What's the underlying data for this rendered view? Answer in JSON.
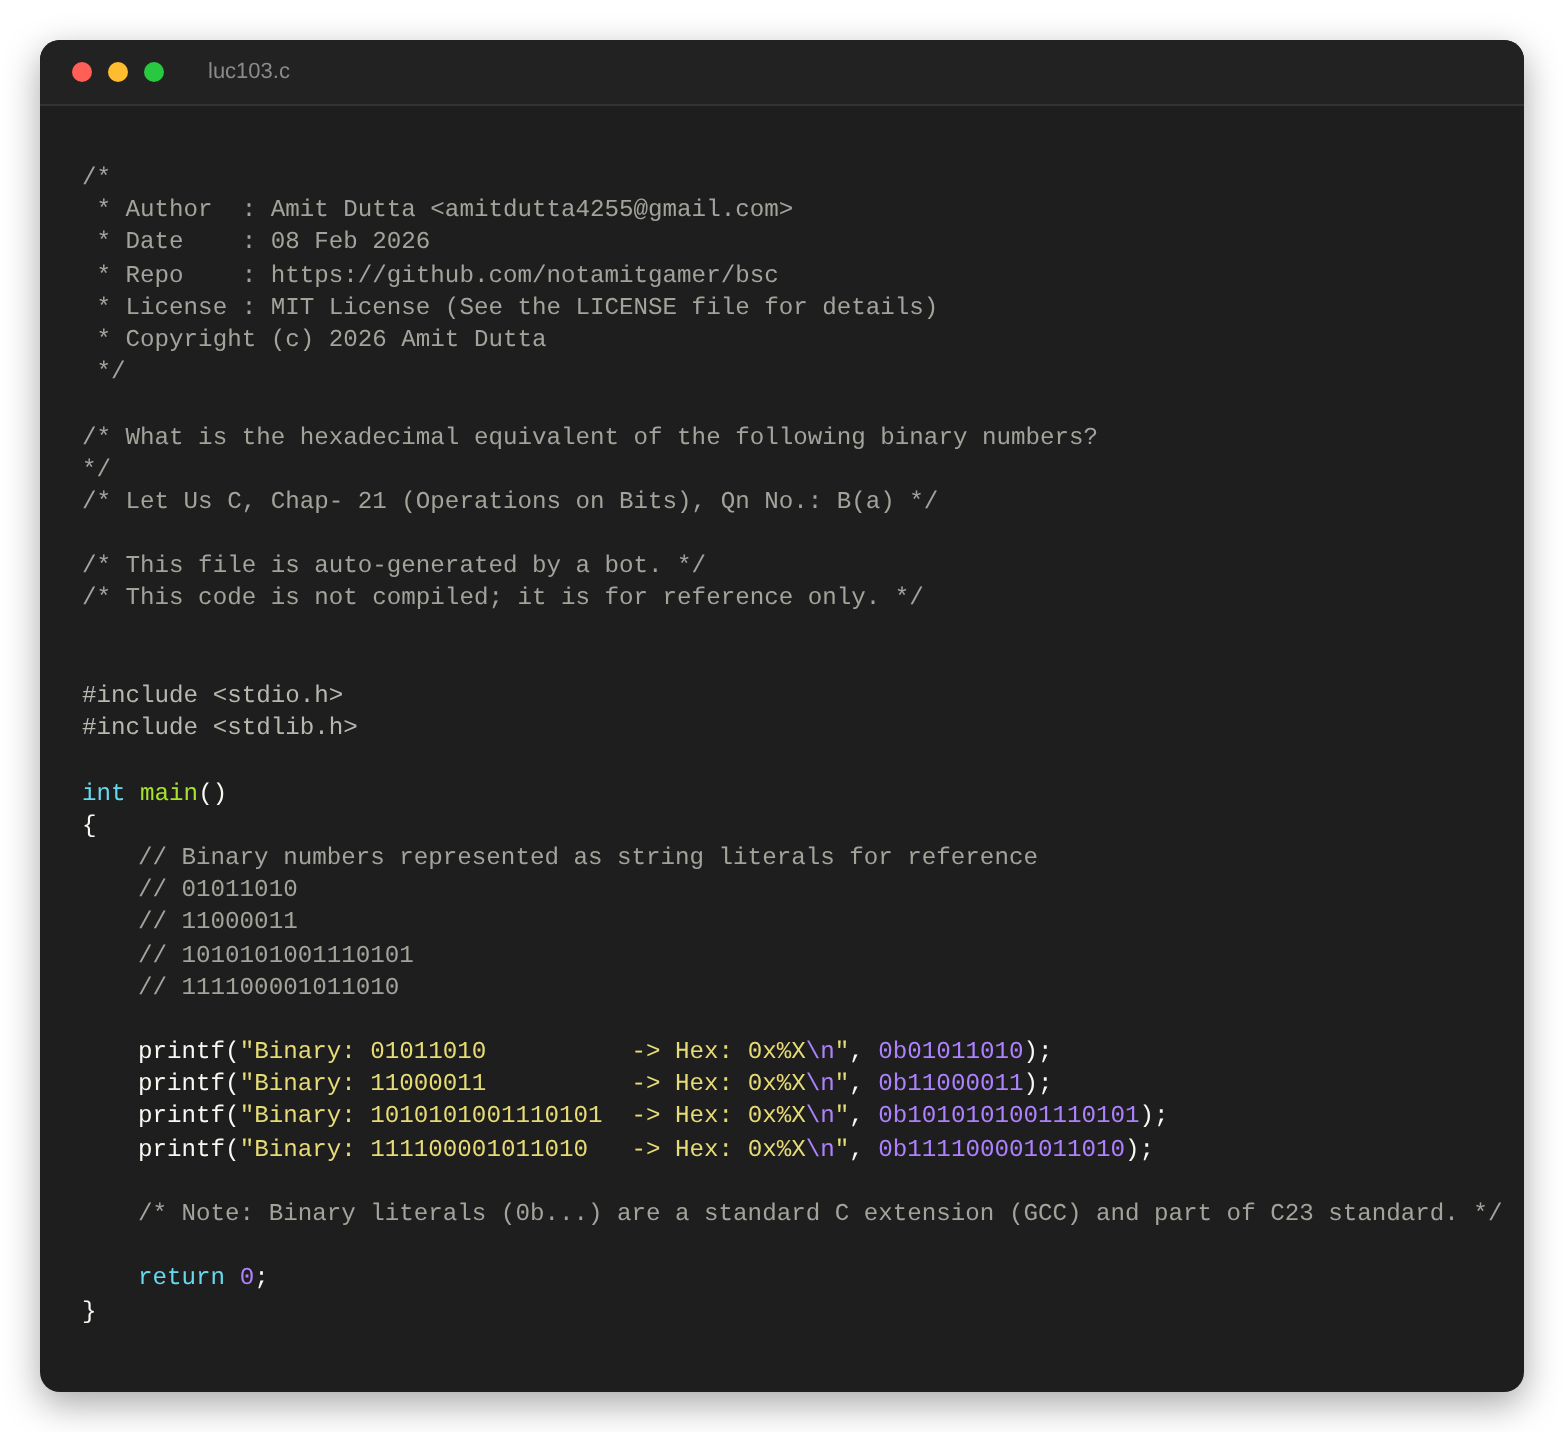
{
  "window": {
    "title": "luc103.c"
  },
  "blocks": [
    {
      "kind": "first",
      "lines": [
        {
          "indented": false,
          "tokens": [
            {
              "kind": "comment",
              "text": "/*"
            }
          ]
        },
        {
          "indented": false,
          "tokens": [
            {
              "kind": "comment",
              "text": " * Author  : Amit Dutta <amitdutta4255@gmail.com>"
            }
          ]
        },
        {
          "indented": false,
          "tokens": [
            {
              "kind": "comment",
              "text": " * Date    : 08 Feb 2026"
            }
          ]
        },
        {
          "indented": false,
          "tokens": [
            {
              "kind": "comment",
              "text": " * Repo    : https://github.com/notamitgamer/bsc"
            }
          ]
        },
        {
          "indented": false,
          "tokens": [
            {
              "kind": "comment",
              "text": " * License : MIT License (See the LICENSE file for details)"
            }
          ]
        },
        {
          "indented": false,
          "tokens": [
            {
              "kind": "comment",
              "text": " * Copyright (c) 2026 Amit Dutta"
            }
          ]
        },
        {
          "indented": false,
          "tokens": [
            {
              "kind": "comment",
              "text": " */"
            }
          ]
        }
      ]
    },
    {
      "kind": "section",
      "lines": [
        {
          "indented": false,
          "tokens": [
            {
              "kind": "comment",
              "text": "/* What is the hexadecimal equivalent of the following binary numbers?"
            }
          ]
        },
        {
          "indented": false,
          "tokens": [
            {
              "kind": "comment",
              "text": "*/"
            }
          ]
        },
        {
          "indented": false,
          "tokens": [
            {
              "kind": "comment",
              "text": "/* Let Us C, Chap- 21 (Operations on Bits), Qn No.: B(a) */"
            }
          ]
        }
      ]
    },
    {
      "kind": "section",
      "lines": [
        {
          "indented": false,
          "tokens": [
            {
              "kind": "comment",
              "text": "/* This file is auto-generated by a bot. */"
            }
          ]
        },
        {
          "indented": false,
          "tokens": [
            {
              "kind": "comment",
              "text": "/* This code is not compiled; it is for reference only. */"
            }
          ]
        }
      ]
    },
    {
      "kind": "wide-section",
      "lines": [
        {
          "indented": false,
          "tokens": [
            {
              "kind": "preprocessor",
              "text": "#include <stdio.h>"
            }
          ]
        },
        {
          "indented": false,
          "tokens": [
            {
              "kind": "preprocessor",
              "text": "#include <stdlib.h>"
            }
          ]
        }
      ]
    },
    {
      "kind": "section",
      "lines": [
        {
          "indented": false,
          "tokens": [
            {
              "kind": "keyword",
              "text": "int "
            },
            {
              "kind": "function",
              "text": "main"
            },
            {
              "kind": "plain",
              "text": "()"
            }
          ]
        },
        {
          "indented": false,
          "tokens": [
            {
              "kind": "plain",
              "text": "{"
            }
          ]
        },
        {
          "indented": true,
          "tokens": [
            {
              "kind": "comment",
              "text": "// Binary numbers represented as string literals for reference"
            }
          ]
        },
        {
          "indented": true,
          "tokens": [
            {
              "kind": "comment",
              "text": "// 01011010"
            }
          ]
        },
        {
          "indented": true,
          "tokens": [
            {
              "kind": "comment",
              "text": "// 11000011"
            }
          ]
        },
        {
          "indented": true,
          "tokens": [
            {
              "kind": "comment",
              "text": "// 1010101001110101"
            }
          ]
        },
        {
          "indented": true,
          "tokens": [
            {
              "kind": "comment",
              "text": "// 111100001011010"
            }
          ]
        }
      ]
    },
    {
      "kind": "section",
      "lines": [
        {
          "indented": true,
          "tokens": [
            {
              "kind": "plain",
              "text": "printf("
            },
            {
              "kind": "string",
              "text": "\"Binary: 01011010          -> Hex: 0x%X"
            },
            {
              "kind": "escape",
              "text": "\\n"
            },
            {
              "kind": "string",
              "text": "\""
            },
            {
              "kind": "plain",
              "text": ", "
            },
            {
              "kind": "number",
              "text": "0b01011010"
            },
            {
              "kind": "plain",
              "text": ");"
            }
          ]
        },
        {
          "indented": true,
          "tokens": [
            {
              "kind": "plain",
              "text": "printf("
            },
            {
              "kind": "string",
              "text": "\"Binary: 11000011          -> Hex: 0x%X"
            },
            {
              "kind": "escape",
              "text": "\\n"
            },
            {
              "kind": "string",
              "text": "\""
            },
            {
              "kind": "plain",
              "text": ", "
            },
            {
              "kind": "number",
              "text": "0b11000011"
            },
            {
              "kind": "plain",
              "text": ");"
            }
          ]
        },
        {
          "indented": true,
          "tokens": [
            {
              "kind": "plain",
              "text": "printf("
            },
            {
              "kind": "string",
              "text": "\"Binary: 1010101001110101  -> Hex: 0x%X"
            },
            {
              "kind": "escape",
              "text": "\\n"
            },
            {
              "kind": "string",
              "text": "\""
            },
            {
              "kind": "plain",
              "text": ", "
            },
            {
              "kind": "number",
              "text": "0b1010101001110101"
            },
            {
              "kind": "plain",
              "text": ");"
            }
          ]
        },
        {
          "indented": true,
          "tokens": [
            {
              "kind": "plain",
              "text": "printf("
            },
            {
              "kind": "string",
              "text": "\"Binary: 111100001011010   -> Hex: 0x%X"
            },
            {
              "kind": "escape",
              "text": "\\n"
            },
            {
              "kind": "string",
              "text": "\""
            },
            {
              "kind": "plain",
              "text": ", "
            },
            {
              "kind": "number",
              "text": "0b111100001011010"
            },
            {
              "kind": "plain",
              "text": ");"
            }
          ]
        }
      ]
    },
    {
      "kind": "section",
      "lines": [
        {
          "indented": true,
          "tokens": [
            {
              "kind": "comment",
              "text": "/* Note: Binary literals (0b...) are a standard C extension (GCC) and part of C23 standard. */"
            }
          ]
        }
      ]
    },
    {
      "kind": "section",
      "lines": [
        {
          "indented": true,
          "tokens": [
            {
              "kind": "keyword",
              "text": "return "
            },
            {
              "kind": "number",
              "text": "0"
            },
            {
              "kind": "plain",
              "text": ";"
            }
          ]
        },
        {
          "indented": false,
          "tokens": [
            {
              "kind": "plain",
              "text": "}"
            }
          ]
        }
      ]
    }
  ]
}
